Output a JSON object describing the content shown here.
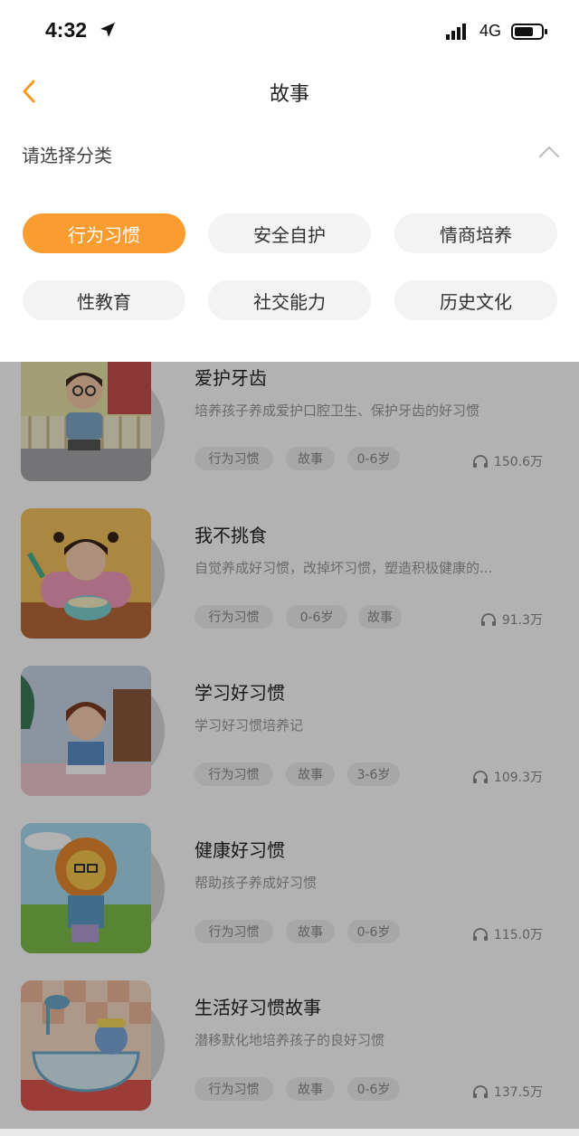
{
  "status_bar": {
    "time": "4:32",
    "network": "4G"
  },
  "nav": {
    "title": "故事"
  },
  "category": {
    "header": "请选择分类",
    "chips": [
      "行为习惯",
      "安全自护",
      "情商培养",
      "性教育",
      "社交能力",
      "历史文化"
    ],
    "active_index": 0
  },
  "stories": [
    {
      "title": "爱护牙齿",
      "desc": "培养孩子养成爱护口腔卫生、保护牙齿的好习惯",
      "tags": [
        "行为习惯",
        "故事",
        "0-6岁"
      ],
      "plays": "150.6万"
    },
    {
      "title": "我不挑食",
      "desc": "自觉养成好习惯，改掉坏习惯，塑造积极健康的...",
      "tags": [
        "行为习惯",
        "0-6岁",
        "故事"
      ],
      "plays": "91.3万"
    },
    {
      "title": "学习好习惯",
      "desc": "学习好习惯培养记",
      "tags": [
        "行为习惯",
        "故事",
        "3-6岁"
      ],
      "plays": "109.3万"
    },
    {
      "title": "健康好习惯",
      "desc": "帮助孩子养成好习惯",
      "tags": [
        "行为习惯",
        "故事",
        "0-6岁"
      ],
      "plays": "115.0万"
    },
    {
      "title": "生活好习惯故事",
      "desc": "潜移默化地培养孩子的良好习惯",
      "tags": [
        "行为习惯",
        "故事",
        "0-6岁"
      ],
      "plays": "137.5万"
    }
  ],
  "colors": {
    "accent": "#fa9c30",
    "chip_bg": "#f3f3f3",
    "overlay": "rgba(0,0,0,0.30)"
  },
  "icons": {
    "back": "chevron-left-icon",
    "collapse": "chevron-up-icon",
    "plays": "headphone-icon"
  }
}
